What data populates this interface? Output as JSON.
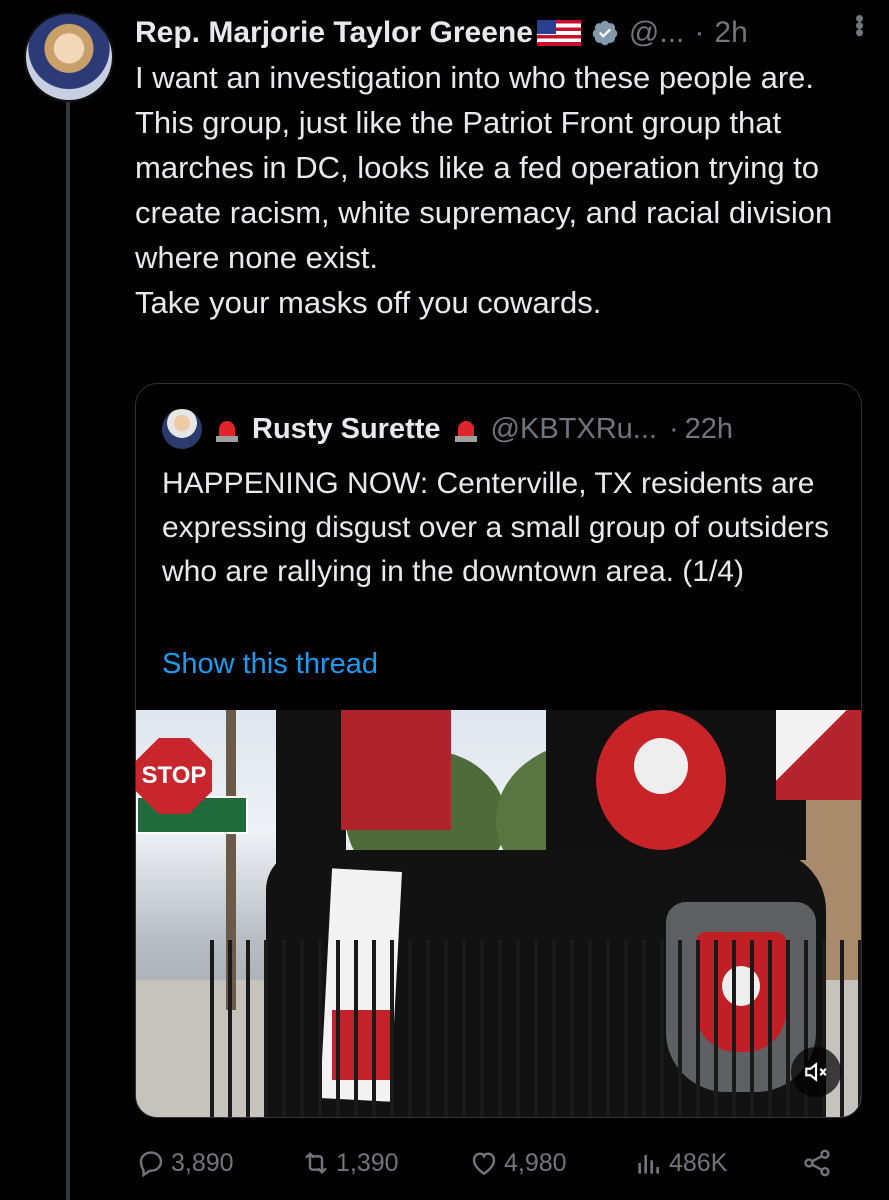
{
  "tweet": {
    "author_name": "Rep. Marjorie Taylor Greene",
    "handle": "@...",
    "separator": "·",
    "time": "2h",
    "more_icon": "more-vertical-icon",
    "text": "I want an investigation into who these people are.\nThis group, just like the Patriot Front group that marches in DC, looks like a fed operation trying to create racism, white supremacy, and racial division where none exist.\nTake your masks off you cowards."
  },
  "quote": {
    "author_name": "Rusty Surette",
    "handle": "@KBTXRu...",
    "separator": "·",
    "time": "22h",
    "text": "HAPPENING NOW: Centerville, TX residents are expressing disgust over a small group of outsiders who are rallying in the downtown area.  (1/4)",
    "show_thread": "Show this thread",
    "media_stop_sign": "STOP",
    "media_icon": "mute-icon"
  },
  "actions": {
    "replies": "3,890",
    "retweets": "1,390",
    "likes": "4,980",
    "views": "486K"
  },
  "colors": {
    "background": "#000000",
    "text": "#e7e9ea",
    "muted": "#71767b",
    "link": "#1d9bf0",
    "verified": "#829aab",
    "border": "#2f3336"
  }
}
